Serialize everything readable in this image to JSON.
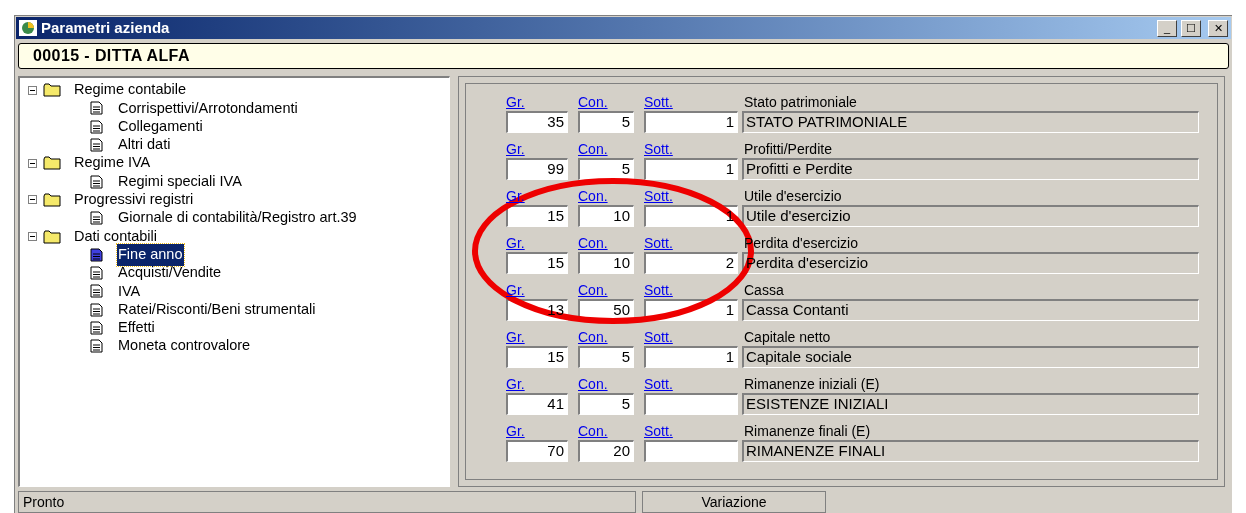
{
  "window": {
    "title": "Parametri azienda",
    "controls": [
      "_",
      "☐",
      "✕"
    ]
  },
  "company": "00015 - DITTA ALFA",
  "tree": [
    {
      "label": "Regime contabile",
      "expanded": true,
      "selected": false,
      "children": [
        {
          "label": "Corrispettivi/Arrotondamenti",
          "selected": false
        },
        {
          "label": "Collegamenti",
          "selected": false
        },
        {
          "label": "Altri dati",
          "selected": false
        }
      ]
    },
    {
      "label": "Regime IVA",
      "expanded": true,
      "selected": false,
      "children": [
        {
          "label": "Regimi speciali IVA",
          "selected": false
        }
      ]
    },
    {
      "label": "Progressivi registri",
      "expanded": true,
      "selected": false,
      "children": [
        {
          "label": "Giornale di contabilità/Registro art.39",
          "selected": false
        }
      ]
    },
    {
      "label": "Dati contabili",
      "expanded": true,
      "selected": false,
      "children": [
        {
          "label": "Fine anno",
          "selected": true
        },
        {
          "label": "Acquisti/Vendite",
          "selected": false
        },
        {
          "label": "IVA",
          "selected": false
        },
        {
          "label": "Ratei/Risconti/Beni strumentali",
          "selected": false
        },
        {
          "label": "Effetti",
          "selected": false
        },
        {
          "label": "Moneta controvalore",
          "selected": false
        }
      ]
    }
  ],
  "accounts": [
    {
      "title": "Stato patrimoniale",
      "gr_label": "Gr.",
      "con_label": "Con.",
      "sott_label": "Sott.",
      "gr": "35",
      "con": "5",
      "sott": "1",
      "description": "STATO PATRIMONIALE"
    },
    {
      "title": "Profitti/Perdite",
      "gr_label": "Gr.",
      "con_label": "Con.",
      "sott_label": "Sott.",
      "gr": "99",
      "con": "5",
      "sott": "1",
      "description": "Profitti e Perdite"
    },
    {
      "title": "Utile d'esercizio",
      "gr_label": "Gr.",
      "con_label": "Con.",
      "sott_label": "Sott.",
      "gr": "15",
      "con": "10",
      "sott": "1",
      "description": "Utile d'esercizio"
    },
    {
      "title": "Perdita d'esercizio",
      "gr_label": "Gr.",
      "con_label": "Con.",
      "sott_label": "Sott.",
      "gr": "15",
      "con": "10",
      "sott": "2",
      "description": "Perdita d'esercizio"
    },
    {
      "title": "Cassa",
      "gr_label": "Gr.",
      "con_label": "Con.",
      "sott_label": "Sott.",
      "gr": "13",
      "con": "50",
      "sott": "1",
      "description": "Cassa Contanti"
    },
    {
      "title": "Capitale netto",
      "gr_label": "Gr.",
      "con_label": "Con.",
      "sott_label": "Sott.",
      "gr": "15",
      "con": "5",
      "sott": "1",
      "description": "Capitale sociale"
    },
    {
      "title": "Rimanenze iniziali (E)",
      "gr_label": "Gr.",
      "con_label": "Con.",
      "sott_label": "Sott.",
      "gr": "41",
      "con": "5",
      "description": "ESISTENZE INIZIALI"
    },
    {
      "title": "Rimanenze finali (E)",
      "gr_label": "Gr.",
      "con_label": "Con.",
      "sott_label": "Sott.",
      "gr": "70",
      "con": "20",
      "description": "RIMANENZE FINALI"
    }
  ],
  "status_bar": {
    "status": "Pronto",
    "mode": "Variazione"
  }
}
